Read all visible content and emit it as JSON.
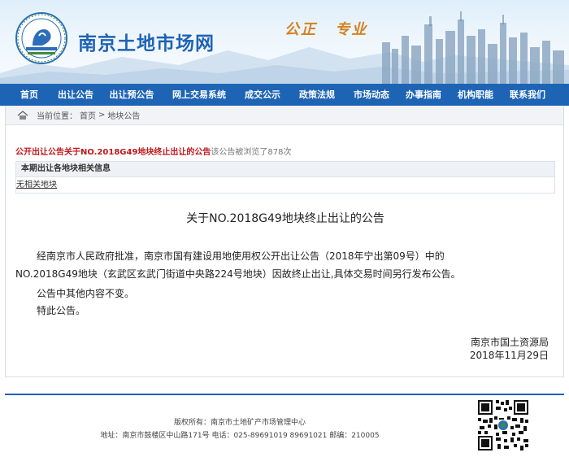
{
  "header": {
    "site_title": "南京土地市场网",
    "slogan_1": "公正",
    "slogan_2": "专业"
  },
  "nav": {
    "items": [
      "首页",
      "出让公告",
      "出让预公告",
      "网上交易系统",
      "成交公示",
      "政策法规",
      "市场动态",
      "办事指南",
      "机构职能",
      "联系我们"
    ]
  },
  "breadcrumb": {
    "prefix": "当前位置：",
    "home": "首页",
    "separator": ">",
    "current": "地块公告"
  },
  "notice": {
    "label": "公开出让公告关于NO.2018G49地块终止出让的公告",
    "views": "该公告被浏览了878次"
  },
  "info": {
    "header": "本期出让各地块相关信息",
    "link": "无相关地块"
  },
  "article": {
    "title": "关于NO.2018G49地块终止出让的公告",
    "para1_line1": "经南京市人民政府批准，南京市国有建设用地使用权公开出让公告（2018年宁出第09号）中的",
    "para1_line2": "NO.2018G49地块（玄武区玄武门街道中央路224号地块）因故终止出让,具体交易时间另行发布公告。",
    "para2": "公告中其他内容不变。",
    "para3": "特此公告。",
    "sign_org": "南京市国土资源局",
    "sign_date": "2018年11月29日"
  },
  "footer": {
    "copyright": "版权所有：南京市土地矿产市场管理中心",
    "address": "地址：南京市鼓楼区中山路171号 电话：025-89691019 89691021 邮编：210005"
  },
  "colors": {
    "nav_bg": "#1e64b4",
    "title_blue": "#1f63b4",
    "slogan": "#d4821e",
    "red": "#c0171b"
  }
}
